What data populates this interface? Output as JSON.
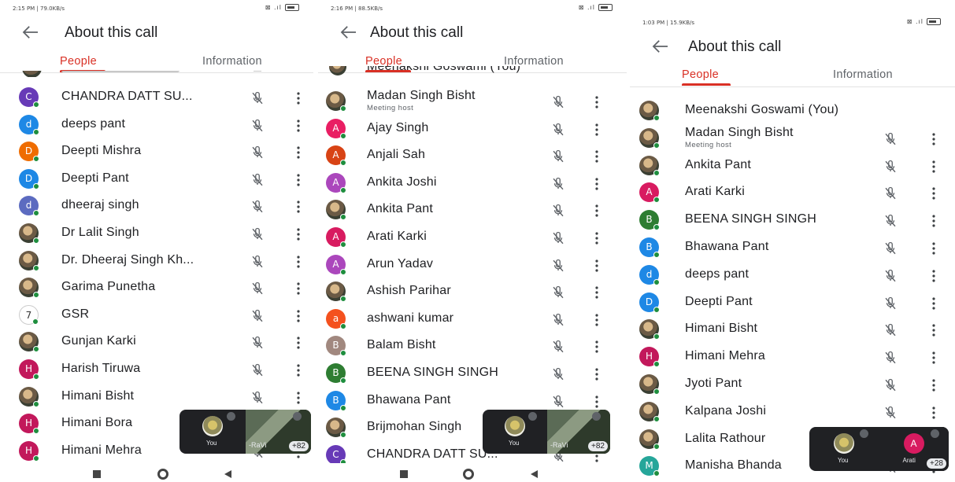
{
  "colors": {
    "accent": "#d93025",
    "online": "#1e8e3e"
  },
  "screens": [
    {
      "status_left": "2:15 PM | 79.0KB/s",
      "status_right": "⊠ .ıl",
      "title": "About this call",
      "tabs": {
        "people": "People",
        "information": "Information"
      },
      "partial_top_name": "",
      "participants": [
        {
          "name": "CHANDRA DATT SU...",
          "initial": "C",
          "color": "#673ab7",
          "kind": "letter",
          "sub": ""
        },
        {
          "name": "deeps pant",
          "initial": "d",
          "color": "#1e88e5",
          "kind": "letter",
          "sub": ""
        },
        {
          "name": "Deepti Mishra",
          "initial": "D",
          "color": "#ef6c00",
          "kind": "letter",
          "sub": ""
        },
        {
          "name": "Deepti Pant",
          "initial": "D",
          "color": "#1e88e5",
          "kind": "letter",
          "sub": ""
        },
        {
          "name": "dheeraj singh",
          "initial": "d",
          "color": "#5c6bc0",
          "kind": "letter",
          "sub": ""
        },
        {
          "name": "Dr Lalit Singh",
          "initial": "",
          "color": "",
          "kind": "photo",
          "sub": ""
        },
        {
          "name": "Dr. Dheeraj Singh Kh...",
          "initial": "",
          "color": "",
          "kind": "photo",
          "sub": ""
        },
        {
          "name": "Garima Punetha",
          "initial": "",
          "color": "",
          "kind": "photo",
          "sub": ""
        },
        {
          "name": "GSR",
          "initial": "7",
          "color": "",
          "kind": "plain",
          "sub": ""
        },
        {
          "name": "Gunjan Karki",
          "initial": "",
          "color": "",
          "kind": "photo",
          "sub": ""
        },
        {
          "name": "Harish Tiruwa",
          "initial": "H",
          "color": "#c2185b",
          "kind": "letter",
          "sub": ""
        },
        {
          "name": "Himani Bisht",
          "initial": "",
          "color": "",
          "kind": "photo",
          "sub": ""
        },
        {
          "name": "Himani Bora",
          "initial": "H",
          "color": "#c2185b",
          "kind": "letter",
          "sub": ""
        },
        {
          "name": "Himani Mehra",
          "initial": "H",
          "color": "#c2185b",
          "kind": "letter",
          "sub": ""
        }
      ],
      "pip": {
        "you": "You",
        "other": "-RaVi",
        "count": "+82"
      }
    },
    {
      "status_left": "2:16 PM | 88.5KB/s",
      "status_right": "⊠ .ıl",
      "title": "About this call",
      "tabs": {
        "people": "People",
        "information": "Information"
      },
      "partial_top_name": "Meenakshi Goswami (You)",
      "participants": [
        {
          "name": "Madan Singh Bisht",
          "initial": "",
          "color": "",
          "kind": "photo",
          "sub": "Meeting host"
        },
        {
          "name": "Ajay Singh",
          "initial": "A",
          "color": "#e91e63",
          "kind": "letter",
          "sub": ""
        },
        {
          "name": "Anjali Sah",
          "initial": "A",
          "color": "#d84315",
          "kind": "letter",
          "sub": ""
        },
        {
          "name": "Ankita Joshi",
          "initial": "A",
          "color": "#ab47bc",
          "kind": "letter",
          "sub": ""
        },
        {
          "name": "Ankita Pant",
          "initial": "",
          "color": "",
          "kind": "photo",
          "sub": ""
        },
        {
          "name": "Arati Karki",
          "initial": "A",
          "color": "#d81b60",
          "kind": "letter",
          "sub": ""
        },
        {
          "name": "Arun Yadav",
          "initial": "A",
          "color": "#ab47bc",
          "kind": "letter",
          "sub": ""
        },
        {
          "name": "Ashish Parihar",
          "initial": "",
          "color": "",
          "kind": "photo",
          "sub": ""
        },
        {
          "name": "ashwani kumar",
          "initial": "a",
          "color": "#f4511e",
          "kind": "letter",
          "sub": ""
        },
        {
          "name": "Balam Bisht",
          "initial": "B",
          "color": "#a1887f",
          "kind": "letter",
          "sub": ""
        },
        {
          "name": "BEENA SINGH SINGH",
          "initial": "B",
          "color": "#2e7d32",
          "kind": "letter",
          "sub": ""
        },
        {
          "name": "Bhawana Pant",
          "initial": "B",
          "color": "#1e88e5",
          "kind": "letter",
          "sub": ""
        },
        {
          "name": "Brijmohan Singh",
          "initial": "",
          "color": "",
          "kind": "photo",
          "sub": ""
        },
        {
          "name": "CHANDRA DATT SU...",
          "initial": "C",
          "color": "#673ab7",
          "kind": "letter",
          "sub": ""
        }
      ],
      "pip": {
        "you": "You",
        "other": "-RaVi",
        "count": "+82"
      }
    },
    {
      "status_left": "1:03 PM | 15.9KB/s",
      "status_right": "⊠ .ıl",
      "title": "About this call",
      "tabs": {
        "people": "People",
        "information": "Information"
      },
      "partial_top_name": "",
      "participants": [
        {
          "name": "Meenakshi Goswami (You)",
          "initial": "",
          "color": "",
          "kind": "photo",
          "sub": ""
        },
        {
          "name": "Madan Singh Bisht",
          "initial": "",
          "color": "",
          "kind": "photo",
          "sub": "Meeting host"
        },
        {
          "name": "Ankita Pant",
          "initial": "",
          "color": "",
          "kind": "photo",
          "sub": ""
        },
        {
          "name": "Arati Karki",
          "initial": "A",
          "color": "#d81b60",
          "kind": "letter",
          "sub": ""
        },
        {
          "name": "BEENA SINGH SINGH",
          "initial": "B",
          "color": "#2e7d32",
          "kind": "letter",
          "sub": ""
        },
        {
          "name": "Bhawana Pant",
          "initial": "B",
          "color": "#1e88e5",
          "kind": "letter",
          "sub": ""
        },
        {
          "name": "deeps pant",
          "initial": "d",
          "color": "#1e88e5",
          "kind": "letter",
          "sub": ""
        },
        {
          "name": "Deepti Pant",
          "initial": "D",
          "color": "#1e88e5",
          "kind": "letter",
          "sub": ""
        },
        {
          "name": "Himani Bisht",
          "initial": "",
          "color": "",
          "kind": "photo",
          "sub": ""
        },
        {
          "name": "Himani Mehra",
          "initial": "H",
          "color": "#c2185b",
          "kind": "letter",
          "sub": ""
        },
        {
          "name": "Jyoti Pant",
          "initial": "",
          "color": "",
          "kind": "photo",
          "sub": ""
        },
        {
          "name": "Kalpana Joshi",
          "initial": "",
          "color": "",
          "kind": "photo",
          "sub": ""
        },
        {
          "name": "Lalita Rathour",
          "initial": "",
          "color": "",
          "kind": "photo",
          "sub": ""
        },
        {
          "name": "Manisha Bhanda",
          "initial": "M",
          "color": "#26a69a",
          "kind": "letter",
          "sub": ""
        }
      ],
      "pip": {
        "you": "You",
        "other": "Arati",
        "other_initial": "A",
        "count": "+28"
      }
    }
  ]
}
